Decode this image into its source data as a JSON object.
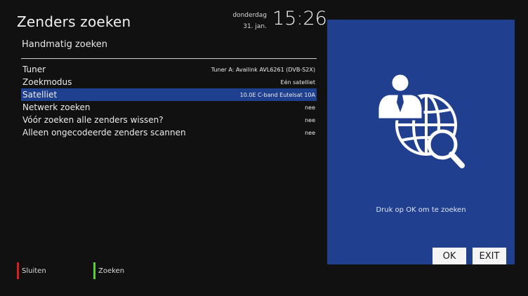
{
  "header": {
    "title": "Zenders zoeken",
    "day": "donderdag",
    "date": "31. jan.",
    "time": "15:26"
  },
  "subtitle": "Handmatig zoeken",
  "settings": [
    {
      "label": "Tuner",
      "value": "Tuner A: Availink AVL6261 (DVB-S2X)"
    },
    {
      "label": "Zoekmodus",
      "value": "Eén satelliet"
    },
    {
      "label": "Satelliet",
      "value": "10.0E C-band Eutelsat 10A"
    },
    {
      "label": "Netwerk zoeken",
      "value": "nee"
    },
    {
      "label": "Vóór zoeken alle zenders wissen?",
      "value": "nee"
    },
    {
      "label": "Alleen ongecodeerde zenders scannen",
      "value": "nee"
    }
  ],
  "color_keys": [
    {
      "color": "#d42020",
      "label": "Sluiten"
    },
    {
      "color": "#5ccf2a",
      "label": "Zoeken"
    }
  ],
  "panel": {
    "icon": "person-globe-search-icon",
    "hint": "Druk op OK om te zoeken",
    "ok_label": "OK",
    "exit_label": "EXIT"
  },
  "colors": {
    "background": "#111111",
    "selection": "#1f3f8f",
    "panel": "#213f8f"
  }
}
